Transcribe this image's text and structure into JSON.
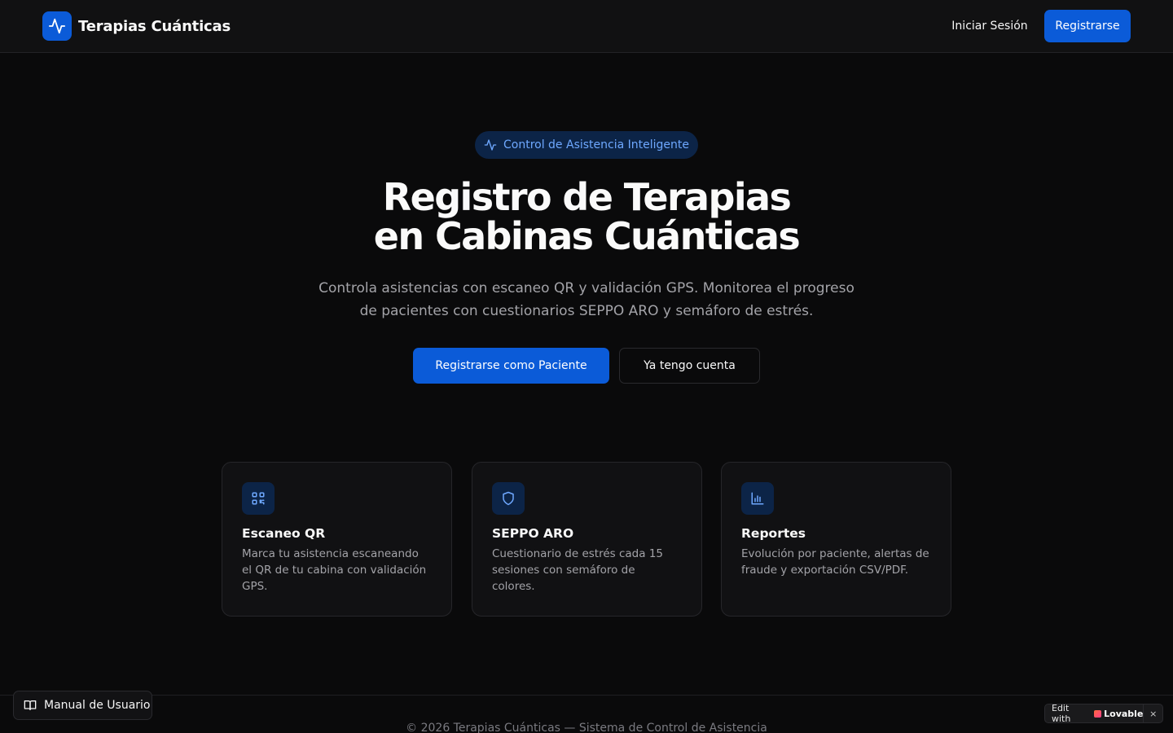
{
  "header": {
    "brand_name": "Terapias Cuánticas",
    "login_label": "Iniciar Sesión",
    "register_label": "Registrarse"
  },
  "hero": {
    "badge": "Control de Asistencia Inteligente",
    "title_line1": "Registro de Terapias",
    "title_line2": "en Cabinas Cuánticas",
    "subtitle_line1": "Controla asistencias con escaneo QR y validación GPS. Monitorea el progreso",
    "subtitle_line2": "de pacientes con cuestionarios SEPPO ARO y semáforo de estrés.",
    "primary_cta": "Registrarse como Paciente",
    "secondary_cta": "Ya tengo cuenta"
  },
  "features": [
    {
      "icon": "qr-code-icon",
      "title": "Escaneo QR",
      "description": "Marca tu asistencia escaneando el QR de tu cabina con validación GPS."
    },
    {
      "icon": "shield-icon",
      "title": "SEPPO ARO",
      "description": "Cuestionario de estrés cada 15 sesiones con semáforo de colores."
    },
    {
      "icon": "bar-chart-icon",
      "title": "Reportes",
      "description": "Evolución por paciente, alertas de fraude y exportación CSV/PDF."
    }
  ],
  "footer": {
    "copyright": "© 2026 Terapias Cuánticas — Sistema de Control de Asistencia",
    "manual_label": "Manual de Usuario"
  },
  "lovable_badge": {
    "edit_with": "Edit with",
    "brand": "Lovable",
    "close": "×"
  },
  "colors": {
    "background": "#0a0a0b",
    "accent": "#0b5bd8",
    "badge_bg": "#0c2447",
    "badge_text": "#6ea8ff"
  }
}
